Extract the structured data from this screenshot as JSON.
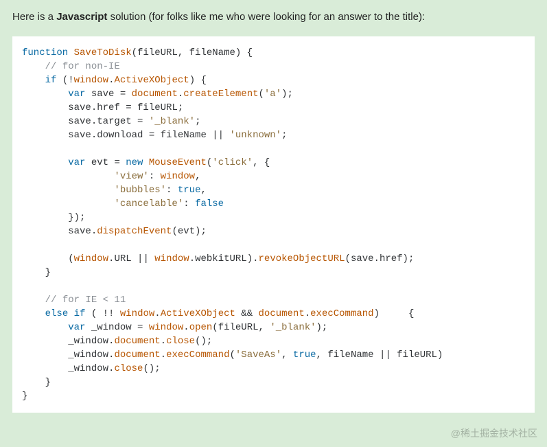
{
  "intro": {
    "pre": "Here is a ",
    "bold": "Javascript",
    "post": " solution (for folks like me who were looking for an answer to the title):"
  },
  "watermark": "@稀土掘金技术社区",
  "code": [
    {
      "indent": 0,
      "tokens": [
        [
          "kw",
          "function"
        ],
        [
          "punct",
          " "
        ],
        [
          "fn",
          "SaveToDisk"
        ],
        [
          "punct",
          "(fileURL, fileName) {"
        ]
      ]
    },
    {
      "indent": 1,
      "tokens": [
        [
          "cmt",
          "// for non-IE"
        ]
      ]
    },
    {
      "indent": 1,
      "tokens": [
        [
          "kw",
          "if"
        ],
        [
          "punct",
          " (!"
        ],
        [
          "fn",
          "window"
        ],
        [
          "punct",
          "."
        ],
        [
          "fn",
          "ActiveXObject"
        ],
        [
          "punct",
          ") {"
        ]
      ]
    },
    {
      "indent": 2,
      "tokens": [
        [
          "kw",
          "var"
        ],
        [
          "punct",
          " save = "
        ],
        [
          "fn",
          "document"
        ],
        [
          "punct",
          "."
        ],
        [
          "fn",
          "createElement"
        ],
        [
          "punct",
          "("
        ],
        [
          "str",
          "'a'"
        ],
        [
          "punct",
          ");"
        ]
      ]
    },
    {
      "indent": 2,
      "tokens": [
        [
          "punct",
          "save.href = fileURL;"
        ]
      ]
    },
    {
      "indent": 2,
      "tokens": [
        [
          "punct",
          "save.target = "
        ],
        [
          "str",
          "'_blank'"
        ],
        [
          "punct",
          ";"
        ]
      ]
    },
    {
      "indent": 2,
      "tokens": [
        [
          "punct",
          "save.download = fileName || "
        ],
        [
          "str",
          "'unknown'"
        ],
        [
          "punct",
          ";"
        ]
      ]
    },
    {
      "indent": 0,
      "tokens": []
    },
    {
      "indent": 2,
      "tokens": [
        [
          "kw",
          "var"
        ],
        [
          "punct",
          " evt = "
        ],
        [
          "kw",
          "new"
        ],
        [
          "punct",
          " "
        ],
        [
          "fn",
          "MouseEvent"
        ],
        [
          "punct",
          "("
        ],
        [
          "str",
          "'click'"
        ],
        [
          "punct",
          ", {"
        ]
      ]
    },
    {
      "indent": 4,
      "tokens": [
        [
          "str",
          "'view'"
        ],
        [
          "punct",
          ": "
        ],
        [
          "fn",
          "window"
        ],
        [
          "punct",
          ","
        ]
      ]
    },
    {
      "indent": 4,
      "tokens": [
        [
          "str",
          "'bubbles'"
        ],
        [
          "punct",
          ": "
        ],
        [
          "kw",
          "true"
        ],
        [
          "punct",
          ","
        ]
      ]
    },
    {
      "indent": 4,
      "tokens": [
        [
          "str",
          "'cancelable'"
        ],
        [
          "punct",
          ": "
        ],
        [
          "kw",
          "false"
        ]
      ]
    },
    {
      "indent": 2,
      "tokens": [
        [
          "punct",
          "});"
        ]
      ]
    },
    {
      "indent": 2,
      "tokens": [
        [
          "punct",
          "save."
        ],
        [
          "fn",
          "dispatchEvent"
        ],
        [
          "punct",
          "(evt);"
        ]
      ]
    },
    {
      "indent": 0,
      "tokens": []
    },
    {
      "indent": 2,
      "tokens": [
        [
          "punct",
          "("
        ],
        [
          "fn",
          "window"
        ],
        [
          "punct",
          ".URL || "
        ],
        [
          "fn",
          "window"
        ],
        [
          "punct",
          ".webkitURL)."
        ],
        [
          "fn",
          "revokeObjectURL"
        ],
        [
          "punct",
          "(save.href);"
        ]
      ]
    },
    {
      "indent": 1,
      "tokens": [
        [
          "punct",
          "}"
        ]
      ]
    },
    {
      "indent": 0,
      "tokens": []
    },
    {
      "indent": 1,
      "tokens": [
        [
          "cmt",
          "// for IE < 11"
        ]
      ]
    },
    {
      "indent": 1,
      "tokens": [
        [
          "kw",
          "else"
        ],
        [
          "punct",
          " "
        ],
        [
          "kw",
          "if"
        ],
        [
          "punct",
          " ( !! "
        ],
        [
          "fn",
          "window"
        ],
        [
          "punct",
          "."
        ],
        [
          "fn",
          "ActiveXObject"
        ],
        [
          "punct",
          " && "
        ],
        [
          "fn",
          "document"
        ],
        [
          "punct",
          "."
        ],
        [
          "fn",
          "execCommand"
        ],
        [
          "punct",
          ")     {"
        ]
      ]
    },
    {
      "indent": 2,
      "tokens": [
        [
          "kw",
          "var"
        ],
        [
          "punct",
          " _window = "
        ],
        [
          "fn",
          "window"
        ],
        [
          "punct",
          "."
        ],
        [
          "fn",
          "open"
        ],
        [
          "punct",
          "(fileURL, "
        ],
        [
          "str",
          "'_blank'"
        ],
        [
          "punct",
          ");"
        ]
      ]
    },
    {
      "indent": 2,
      "tokens": [
        [
          "punct",
          "_window."
        ],
        [
          "fn",
          "document"
        ],
        [
          "punct",
          "."
        ],
        [
          "fn",
          "close"
        ],
        [
          "punct",
          "();"
        ]
      ]
    },
    {
      "indent": 2,
      "tokens": [
        [
          "punct",
          "_window."
        ],
        [
          "fn",
          "document"
        ],
        [
          "punct",
          "."
        ],
        [
          "fn",
          "execCommand"
        ],
        [
          "punct",
          "("
        ],
        [
          "str",
          "'SaveAs'"
        ],
        [
          "punct",
          ", "
        ],
        [
          "kw",
          "true"
        ],
        [
          "punct",
          ", fileName || fileURL)"
        ]
      ]
    },
    {
      "indent": 2,
      "tokens": [
        [
          "punct",
          "_window."
        ],
        [
          "fn",
          "close"
        ],
        [
          "punct",
          "();"
        ]
      ]
    },
    {
      "indent": 1,
      "tokens": [
        [
          "punct",
          "}"
        ]
      ]
    },
    {
      "indent": 0,
      "tokens": [
        [
          "punct",
          "}"
        ]
      ]
    }
  ]
}
